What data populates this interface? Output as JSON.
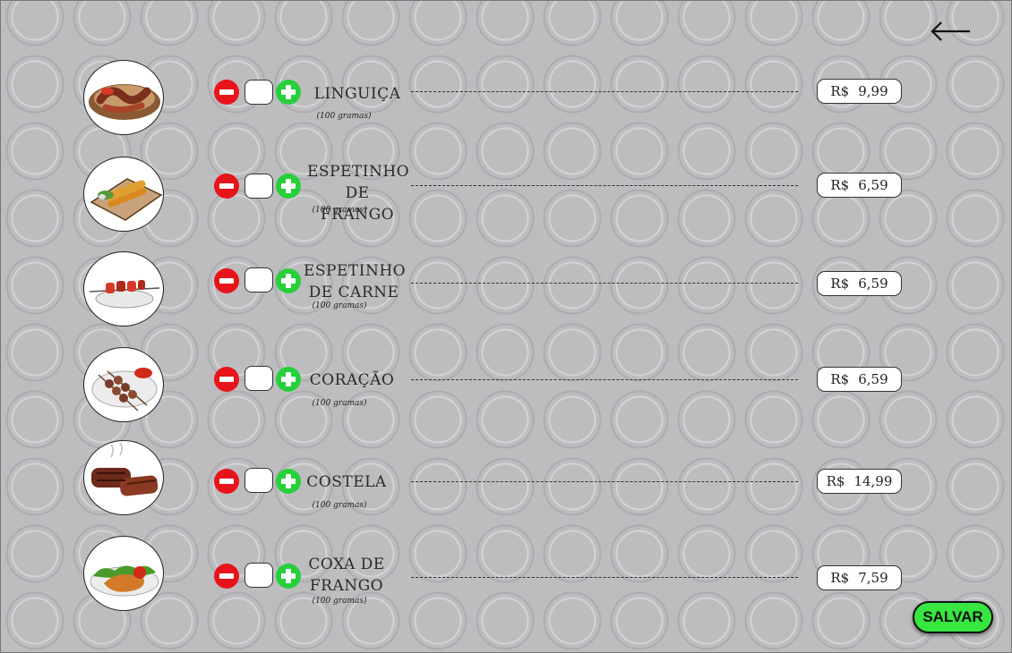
{
  "items": [
    {
      "name": "LINGUIÇA",
      "unit": "(100 gramas)",
      "currency": "R$",
      "price": "9,99",
      "quantity": ""
    },
    {
      "name": "ESPETINHO DE FRANGO",
      "unit": "(100 gramas)",
      "currency": "R$",
      "price": "6,59",
      "quantity": ""
    },
    {
      "name": "ESPETINHO DE CARNE",
      "unit": "(100 gramas)",
      "currency": "R$",
      "price": "6,59",
      "quantity": ""
    },
    {
      "name": "CORAÇÃO",
      "unit": "(100 gramas)",
      "currency": "R$",
      "price": "6,59",
      "quantity": ""
    },
    {
      "name": "COSTELA",
      "unit": "(100 gramas)",
      "currency": "R$",
      "price": "14,99",
      "quantity": ""
    },
    {
      "name": "COXA DE FRANGO",
      "unit": "(100 gramas)",
      "currency": "R$",
      "price": "7,59",
      "quantity": ""
    }
  ],
  "save_label": "SALVAR",
  "icons": {
    "back": "arrow-left-icon",
    "decrease": "minus-circle-icon",
    "increase": "plus-circle-icon"
  },
  "colors": {
    "background": "#bdbdc0",
    "minus": "#e8141b",
    "plus": "#27d03a",
    "save": "#37e63f"
  }
}
